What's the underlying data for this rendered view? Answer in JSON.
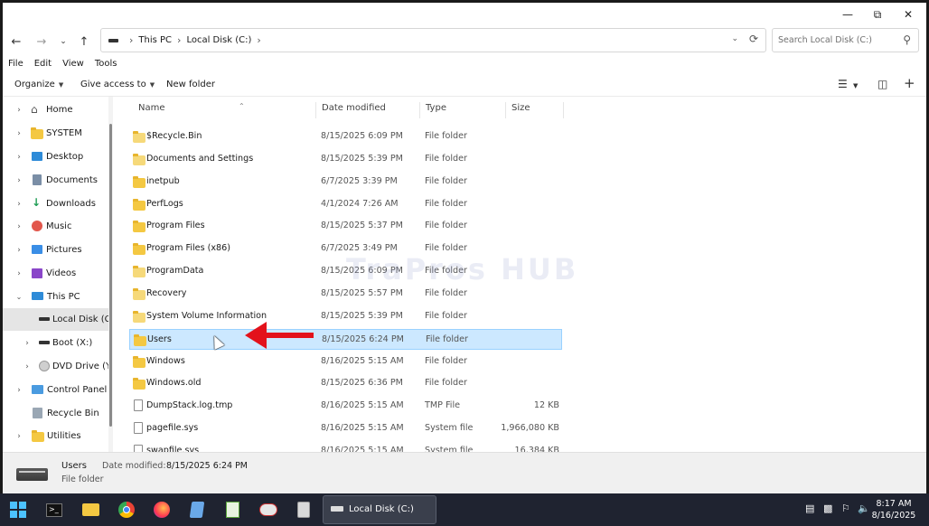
{
  "address": {
    "crumbs": [
      "This PC",
      "Local Disk (C:)"
    ]
  },
  "search": {
    "placeholder": "Search Local Disk (C:)"
  },
  "menu": [
    "File",
    "Edit",
    "View",
    "Tools"
  ],
  "toolbar": {
    "organize": "Organize",
    "give_access": "Give access to",
    "new_folder": "New folder"
  },
  "nav": {
    "items": [
      {
        "label": "Home",
        "icon": "home-icon"
      },
      {
        "label": "SYSTEM",
        "icon": "folder-icon"
      },
      {
        "label": "Desktop",
        "icon": "desktop-icon"
      },
      {
        "label": "Documents",
        "icon": "documents-icon"
      },
      {
        "label": "Downloads",
        "icon": "download-icon"
      },
      {
        "label": "Music",
        "icon": "music-icon"
      },
      {
        "label": "Pictures",
        "icon": "pictures-icon"
      },
      {
        "label": "Videos",
        "icon": "videos-icon"
      },
      {
        "label": "This PC",
        "icon": "computer-icon"
      },
      {
        "label": "Local Disk (C",
        "icon": "drive-icon"
      },
      {
        "label": "Boot (X:)",
        "icon": "drive-icon"
      },
      {
        "label": "DVD Drive (Y:",
        "icon": "dvd-icon"
      },
      {
        "label": "Control Panel",
        "icon": "control-panel-icon"
      },
      {
        "label": "Recycle Bin",
        "icon": "recycle-bin-icon"
      },
      {
        "label": "Utilities",
        "icon": "folder-icon"
      }
    ]
  },
  "columns": {
    "name": "Name",
    "date": "Date modified",
    "type": "Type",
    "size": "Size"
  },
  "files": [
    {
      "name": "$Recycle.Bin",
      "date": "8/15/2025 6:09 PM",
      "type": "File folder",
      "size": "",
      "kind": "folder-pale"
    },
    {
      "name": "Documents and Settings",
      "date": "8/15/2025 5:39 PM",
      "type": "File folder",
      "size": "",
      "kind": "folder-pale"
    },
    {
      "name": "inetpub",
      "date": "6/7/2025 3:39 PM",
      "type": "File folder",
      "size": "",
      "kind": "folder"
    },
    {
      "name": "PerfLogs",
      "date": "4/1/2024 7:26 AM",
      "type": "File folder",
      "size": "",
      "kind": "folder"
    },
    {
      "name": "Program Files",
      "date": "8/15/2025 5:37 PM",
      "type": "File folder",
      "size": "",
      "kind": "folder"
    },
    {
      "name": "Program Files (x86)",
      "date": "6/7/2025 3:49 PM",
      "type": "File folder",
      "size": "",
      "kind": "folder"
    },
    {
      "name": "ProgramData",
      "date": "8/15/2025 6:09 PM",
      "type": "File folder",
      "size": "",
      "kind": "folder-pale"
    },
    {
      "name": "Recovery",
      "date": "8/15/2025 5:57 PM",
      "type": "File folder",
      "size": "",
      "kind": "folder-pale"
    },
    {
      "name": "System Volume Information",
      "date": "8/15/2025 5:39 PM",
      "type": "File folder",
      "size": "",
      "kind": "folder-pale"
    },
    {
      "name": "Users",
      "date": "8/15/2025 6:24 PM",
      "type": "File folder",
      "size": "",
      "kind": "folder"
    },
    {
      "name": "Windows",
      "date": "8/16/2025 5:15 AM",
      "type": "File folder",
      "size": "",
      "kind": "folder"
    },
    {
      "name": "Windows.old",
      "date": "8/15/2025 6:36 PM",
      "type": "File folder",
      "size": "",
      "kind": "folder"
    },
    {
      "name": "DumpStack.log.tmp",
      "date": "8/16/2025 5:15 AM",
      "type": "TMP File",
      "size": "12 KB",
      "kind": "file"
    },
    {
      "name": "pagefile.sys",
      "date": "8/16/2025 5:15 AM",
      "type": "System file",
      "size": "1,966,080 KB",
      "kind": "file"
    },
    {
      "name": "swapfile.sys",
      "date": "8/16/2025 5:15 AM",
      "type": "System file",
      "size": "16,384 KB",
      "kind": "file"
    }
  ],
  "selected_index": 9,
  "watermark": "TraPros HUB",
  "details": {
    "name": "Users",
    "modified_label": "Date modified:",
    "modified_value": "8/15/2025 6:24 PM",
    "type": "File folder"
  },
  "taskbar": {
    "active_window": "Local Disk (C:)",
    "time": "8:17 AM",
    "date": "8/16/2025"
  },
  "colors": {
    "selection": "#cce8ff",
    "arrow": "#e3121b",
    "taskbar": "#1f2330",
    "folder": "#f4c842"
  }
}
